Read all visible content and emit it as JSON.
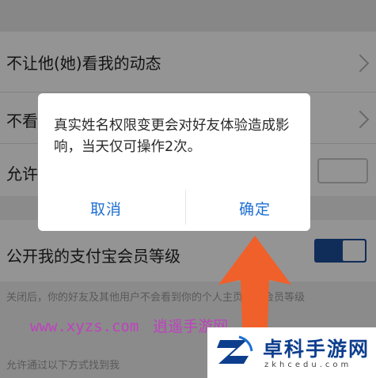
{
  "settings": {
    "rows": [
      {
        "label": "不让他(她)看我的动态"
      },
      {
        "label": "不看"
      },
      {
        "label": "允许"
      },
      {
        "label": "公开我的支付宝会员等级"
      }
    ],
    "description": "关闭后，你的好友及其他用户不会看到你的个人主页等级会员等级",
    "footer_label": "允许通过以下方式找到我"
  },
  "dialog": {
    "message": "真实姓名权限变更会对好友体验造成影响，当天仅可操作2次。",
    "cancel_label": "取消",
    "confirm_label": "确定"
  },
  "watermark": {
    "url": "www.xyzs.com",
    "name": "逍遥手游网"
  },
  "badge": {
    "title": "卓科手游网",
    "subtitle": "zkhcedu.com"
  },
  "colors": {
    "accent_blue": "#1e6fd4",
    "toggle_on": "#1c4f9c",
    "arrow": "#f0602a",
    "watermark": "#c040c0",
    "badge_title": "#0d3e8e"
  }
}
